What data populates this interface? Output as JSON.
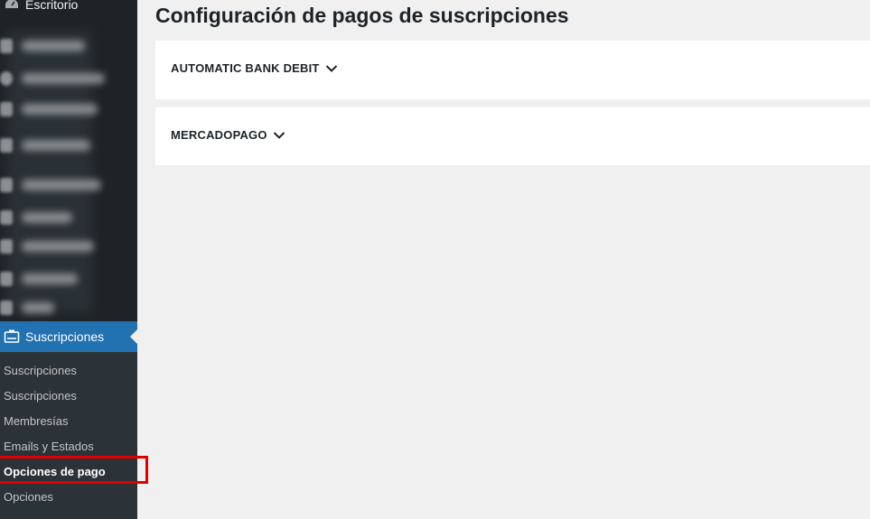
{
  "sidebar": {
    "dashboard_label": "Escritorio",
    "active_item_label": "Suscripciones",
    "submenu": [
      {
        "label": "Suscripciones",
        "current": false
      },
      {
        "label": "Suscripciones",
        "current": false
      },
      {
        "label": "Membresías",
        "current": false
      },
      {
        "label": "Emails y Estados",
        "current": false
      },
      {
        "label": "Opciones de pago",
        "current": true
      },
      {
        "label": "Opciones",
        "current": false
      }
    ]
  },
  "main": {
    "title": "Configuración de pagos de suscripciones",
    "sections": [
      {
        "label": "AUTOMATIC BANK DEBIT"
      },
      {
        "label": "MERCADOPAGO"
      }
    ]
  },
  "colors": {
    "sidebar_bg": "#1d2327",
    "submenu_bg": "#2c3338",
    "active_bg": "#2271b1",
    "highlight_border": "#e00000",
    "content_bg": "#f0f0f1"
  }
}
